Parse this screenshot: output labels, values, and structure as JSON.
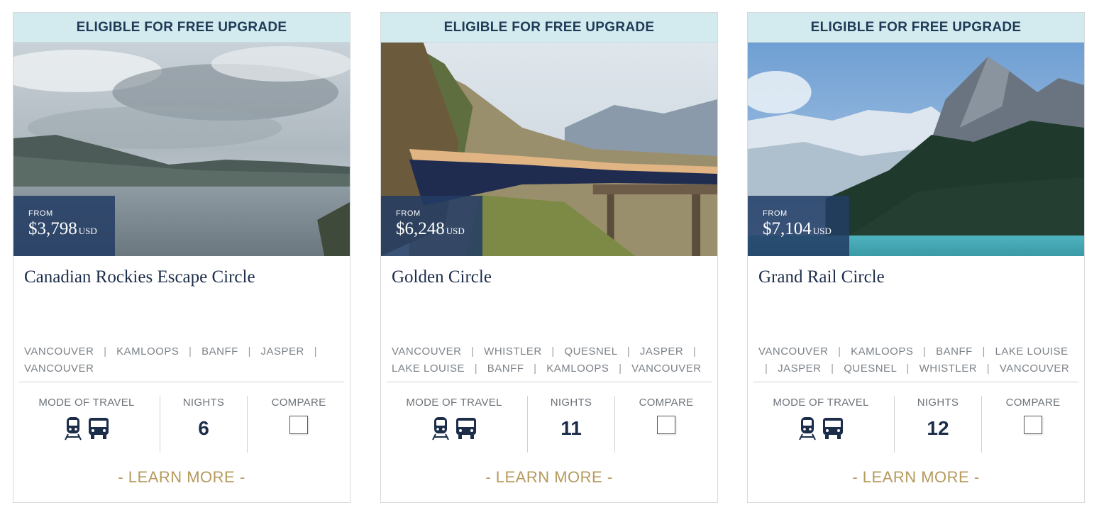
{
  "cards": [
    {
      "banner": "ELIGIBLE FOR FREE UPGRADE",
      "price_from": "FROM",
      "price": "$3,798",
      "currency": "USD",
      "title": "Canadian Rockies Escape Circle",
      "route": [
        "VANCOUVER",
        "KAMLOOPS",
        "BANFF",
        "JASPER",
        "VANCOUVER"
      ],
      "mode_label": "MODE OF TRAVEL",
      "mode_icons": [
        "train-icon",
        "bus-icon"
      ],
      "nights_label": "NIGHTS",
      "nights": "6",
      "compare_label": "COMPARE",
      "learn_more": "- LEARN MORE -"
    },
    {
      "banner": "ELIGIBLE FOR FREE UPGRADE",
      "price_from": "FROM",
      "price": "$6,248",
      "currency": "USD",
      "title": "Golden Circle",
      "route": [
        "VANCOUVER",
        "WHISTLER",
        "QUESNEL",
        "JASPER",
        "LAKE LOUISE",
        "BANFF",
        "KAMLOOPS",
        "VANCOUVER"
      ],
      "mode_label": "MODE OF TRAVEL",
      "mode_icons": [
        "train-icon",
        "bus-icon"
      ],
      "nights_label": "NIGHTS",
      "nights": "11",
      "compare_label": "COMPARE",
      "learn_more": "- LEARN MORE -"
    },
    {
      "banner": "ELIGIBLE FOR FREE UPGRADE",
      "price_from": "FROM",
      "price": "$7,104",
      "currency": "USD",
      "title": "Grand Rail Circle",
      "route": [
        "VANCOUVER",
        "KAMLOOPS",
        "BANFF",
        "LAKE LOUISE",
        "JASPER",
        "QUESNEL",
        "WHISTLER",
        "VANCOUVER"
      ],
      "mode_label": "MODE OF TRAVEL",
      "mode_icons": [
        "train-icon",
        "bus-icon"
      ],
      "nights_label": "NIGHTS",
      "nights": "12",
      "compare_label": "COMPARE",
      "learn_more": "- LEARN MORE -"
    }
  ],
  "colors": {
    "banner_bg": "#d3ebee",
    "navy": "#1c2d4a",
    "price_bg": "#233c64",
    "gold": "#b59a5d",
    "muted_text": "#7c8288"
  }
}
